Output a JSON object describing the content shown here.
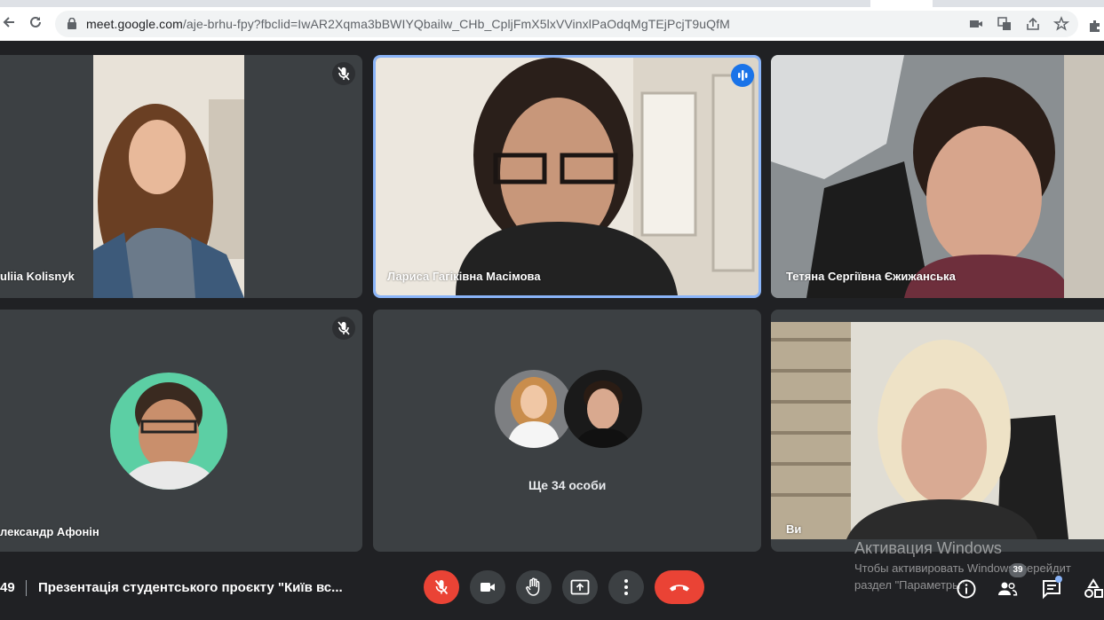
{
  "browser": {
    "url_host": "meet.google.com",
    "url_path": "/aje-brhu-fpy?fbclid=IwAR2Xqma3bBWIYQbailw_CHb_CpljFmX5lxVVinxlPaOdqMgTEjPcjT9uQfM"
  },
  "tiles": [
    {
      "name": "uliia Kolisnyk",
      "muted": true
    },
    {
      "name": "Лариса Гагіківна Масімова",
      "speaking": true
    },
    {
      "name": "Тетяна Сергіївна Єжижанська",
      "muted": false
    },
    {
      "name": "лександр Афонін",
      "muted": true
    },
    {
      "caption": "Ще 34 особи"
    },
    {
      "name": "Ви",
      "muted": false
    }
  ],
  "meeting": {
    "time": "49",
    "title": "Презентація студентського проєкту \"Київ вс..."
  },
  "participants_badge": "39",
  "windows_activation": {
    "line1": "Активация Windows",
    "line2": "Чтобы активировать Windows, перейдит",
    "line3": "раздел \"Параметры\"."
  },
  "colors": {
    "background": "#202124",
    "tile": "#3c4043",
    "accent": "#1a73e8",
    "end_call": "#ea4335"
  }
}
